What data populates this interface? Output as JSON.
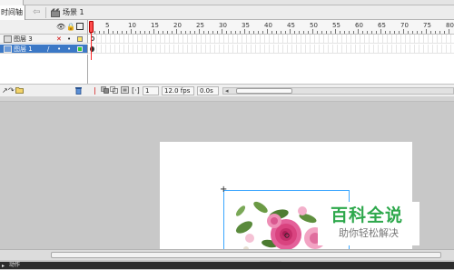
{
  "toolbar": {
    "timeline_tab_label": "时间轴",
    "scene_label": "场景 1"
  },
  "layers": [
    {
      "name": "图层 3",
      "visible_marker": "✕",
      "lock_marker": "•",
      "outline_color": "#ffe566",
      "selected": false
    },
    {
      "name": "图层 1",
      "visible_marker": "•",
      "lock_marker": "•",
      "outline_color": "#33cc33",
      "selected": true
    }
  ],
  "ruler": {
    "labels": [
      "5",
      "10",
      "15",
      "20",
      "25",
      "30",
      "35",
      "40",
      "45",
      "50",
      "55",
      "60",
      "65",
      "70",
      "75",
      "80",
      "85"
    ]
  },
  "footer": {
    "current_frame": "1",
    "frame_rate": "12.0 fps",
    "elapsed": "0.0s"
  },
  "watermark": {
    "title": "百科全说",
    "subtitle": "助你轻松解决"
  },
  "status": {
    "label": "动作"
  },
  "colors": {
    "selected_layer": "#3b78c6",
    "playhead": "#ff2a2a",
    "selection_box": "#3aa6ff",
    "watermark_green": "#2ea84c"
  }
}
